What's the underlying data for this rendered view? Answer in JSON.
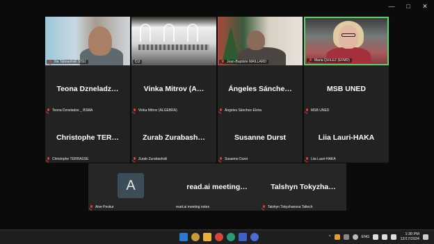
{
  "window": {
    "minimize": "—",
    "maximize": "□",
    "close": "✕"
  },
  "video_tiles": [
    {
      "name": "Ilia Tabnashvili SISU"
    },
    {
      "name": "CU"
    },
    {
      "name": "Jean-Baptiste MAILLARD"
    },
    {
      "name": "Maria QUILEZ (EFMD)"
    }
  ],
  "participants": [
    {
      "title": "Teona  Dzneladz…",
      "name": "Teona Dzneladze _ BSMA"
    },
    {
      "title": "Vinka Mitrov (A…",
      "name": "Vinka Mitrov (ALGEBRA)"
    },
    {
      "title": "Ángeles  Sánche…",
      "name": "Ángeles Sánchez-Elvira"
    },
    {
      "title": "MSB UNED",
      "name": "MSB UNED"
    },
    {
      "title": "Christophe  TER…",
      "name": "Christophe TERRASSE"
    },
    {
      "title": "Zurab  Zurabash…",
      "name": "Zurab Zurabashvili"
    },
    {
      "title": "Susanne Durst",
      "name": "Susanne Durst"
    },
    {
      "title": "Liia Lauri-HAKA",
      "name": "Liia Lauri-HAKA"
    }
  ],
  "bottom_row": [
    {
      "avatar": "A",
      "title": "",
      "name": "Aive Pevkur"
    },
    {
      "avatar": "",
      "title": "read.ai  meeting…",
      "name": "read.ai meeting notes"
    },
    {
      "avatar": "",
      "title": "Talshyn  Tokyzha…",
      "name": "Talshyn Tokyzhanova Taltech"
    }
  ],
  "taskbar": {
    "language": "ENG",
    "time": "1:30 PM",
    "date": "12/17/2024",
    "caret": "^"
  }
}
